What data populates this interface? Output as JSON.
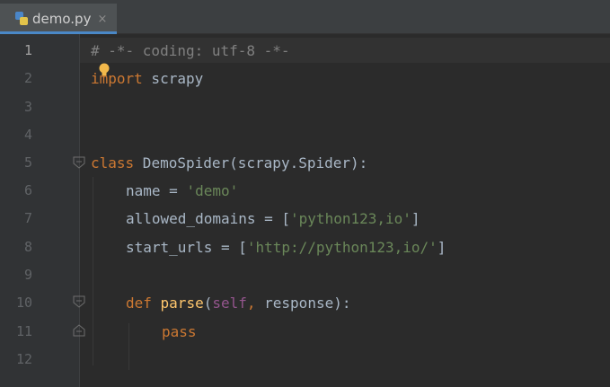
{
  "tab": {
    "filename": "demo.py",
    "close_glyph": "×",
    "icon": "python-file-icon"
  },
  "line_numbers": [
    "1",
    "2",
    "3",
    "4",
    "5",
    "6",
    "7",
    "8",
    "9",
    "10",
    "11",
    "12"
  ],
  "code": {
    "l1": "# -*- coding: utf-8 -*-",
    "l2_kw": "import",
    "l2_rest": " scrapy",
    "l5_kw": "class",
    "l5_name": " DemoSpider",
    "l5_rest": "(scrapy.Spider):",
    "l6_name": "name = ",
    "l6_str": "'demo'",
    "l7_name": "allowed_domains = [",
    "l7_str": "'python123,io'",
    "l7_end": "]",
    "l8_name": "start_urls = [",
    "l8_str": "'http://python123,io/'",
    "l8_end": "]",
    "l10_kw": "def",
    "l10_fn": " parse",
    "l10_p1": "(",
    "l10_self": "self",
    "l10_comma": ",",
    "l10_rest": " response):",
    "l11_kw": "pass"
  },
  "colors": {
    "editor_bg": "#2b2b2b",
    "gutter_bg": "#313335",
    "keyword": "#cc7832",
    "string": "#6a8759",
    "comment": "#808080",
    "self": "#94558d",
    "function": "#ffc66d",
    "text": "#a9b7c6"
  }
}
